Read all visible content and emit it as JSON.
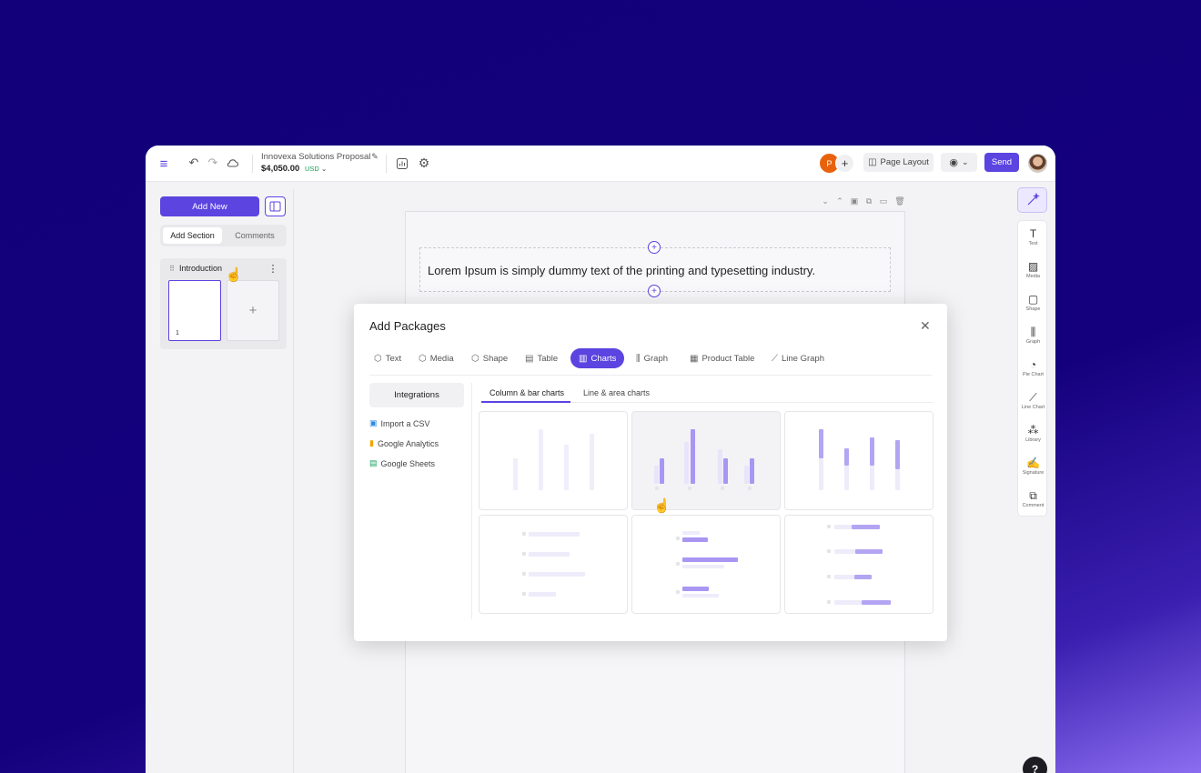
{
  "topbar": {
    "proposal_title": "Innovexa Solutions Proposal",
    "price": "$4,050.00",
    "currency": "USD",
    "collaborator_initial": "P",
    "page_layout_label": "Page Layout",
    "send_label": "Send"
  },
  "left_panel": {
    "add_new_label": "Add New",
    "tabs": [
      "Add Section",
      "Comments"
    ],
    "section_name": "Introduction",
    "page_number": "1"
  },
  "canvas": {
    "text_block": "Lorem Ipsum is simply dummy text of the printing and typesetting industry."
  },
  "right_toolbar": {
    "tools": [
      {
        "label": "Text",
        "icon": "text-icon"
      },
      {
        "label": "Media",
        "icon": "media-icon"
      },
      {
        "label": "Shape",
        "icon": "shape-icon"
      },
      {
        "label": "Graph",
        "icon": "graph-icon"
      },
      {
        "label": "Pie Chart",
        "icon": "pie-chart-icon"
      },
      {
        "label": "Line Chart",
        "icon": "line-chart-icon"
      },
      {
        "label": "Library",
        "icon": "library-icon"
      },
      {
        "label": "Signature",
        "icon": "signature-icon"
      },
      {
        "label": "Comment",
        "icon": "comment-icon"
      }
    ]
  },
  "help_label": "?",
  "modal": {
    "title": "Add Packages",
    "tabs": [
      "Text",
      "Media",
      "Shape",
      "Table",
      "Charts",
      "Graph",
      "Product Table",
      "Line Graph"
    ],
    "active_tab": "Charts",
    "integrations_label": "Integrations",
    "integrations": [
      "Import a CSV",
      "Google Analytics",
      "Google Sheets"
    ],
    "subtabs": [
      "Column & bar charts",
      "Line & area charts"
    ],
    "active_subtab": "Column & bar charts"
  },
  "colors": {
    "accent": "#5b44e0",
    "background": "#12007a",
    "bar_light": "#ece9fb",
    "bar_mid": "#bcaef5"
  }
}
